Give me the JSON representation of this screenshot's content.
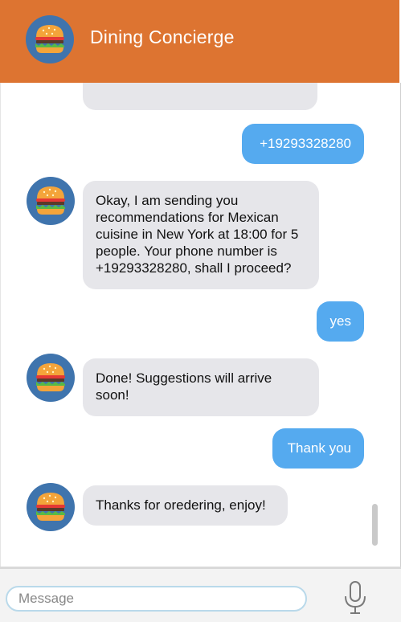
{
  "header": {
    "title": "Dining Concierge",
    "avatar_icon": "burger-icon"
  },
  "colors": {
    "header": "#dd7431",
    "bubble_in": "#e6e6ea",
    "bubble_out": "#55aaef"
  },
  "messages": [
    {
      "from": "user",
      "text": "+19293328280"
    },
    {
      "from": "bot",
      "text": "Okay, I am sending you recommendations for Mexican cuisine in New York at 18:00 for 5 people. Your phone number is +19293328280, shall I proceed?"
    },
    {
      "from": "user",
      "text": "yes"
    },
    {
      "from": "bot",
      "text": "Done! Suggestions will arrive soon!"
    },
    {
      "from": "user",
      "text": "Thank you"
    },
    {
      "from": "bot",
      "text": "Thanks for oredering, enjoy!"
    }
  ],
  "composer": {
    "placeholder": "Message",
    "mic_icon": "microphone-icon"
  }
}
